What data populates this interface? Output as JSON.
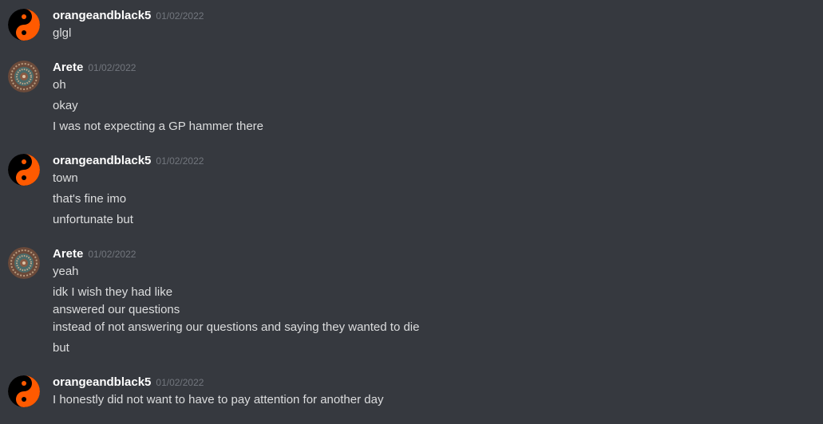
{
  "messages": [
    {
      "author": "orangeandblack5",
      "avatar": "yin-yang-orange",
      "timestamp": "01/02/2022",
      "lines": [
        "glgl"
      ]
    },
    {
      "author": "Arete",
      "avatar": "mandala",
      "timestamp": "01/02/2022",
      "lines": [
        "oh",
        "okay",
        "I was not expecting a GP hammer there"
      ]
    },
    {
      "author": "orangeandblack5",
      "avatar": "yin-yang-orange",
      "timestamp": "01/02/2022",
      "lines": [
        "town",
        "that's fine imo",
        "unfortunate but"
      ]
    },
    {
      "author": "Arete",
      "avatar": "mandala",
      "timestamp": "01/02/2022",
      "lines": [
        "yeah",
        "idk I wish they had like",
        "answered our questions",
        "instead of not answering our questions and saying they wanted to die",
        "but"
      ]
    },
    {
      "author": "orangeandblack5",
      "avatar": "yin-yang-orange",
      "timestamp": "01/02/2022",
      "lines": [
        "I honestly did not want to have to pay attention for another day"
      ]
    }
  ],
  "colors": {
    "background": "#36393f",
    "username": "#ffffff",
    "timestamp": "#72767d",
    "message_text": "#dcddde",
    "yin_yang_orange": "#ff5a00"
  }
}
